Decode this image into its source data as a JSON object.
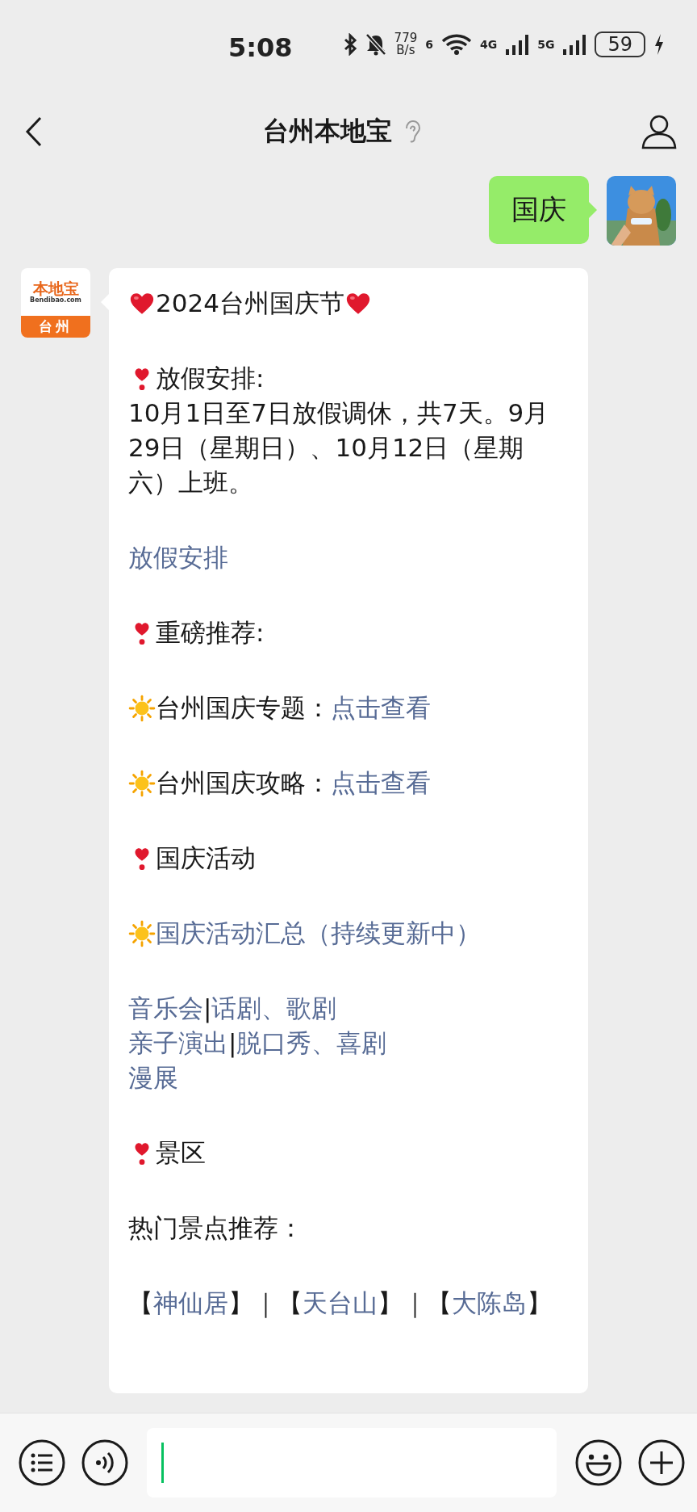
{
  "status_bar": {
    "time": "5:08",
    "speed_value": "779",
    "speed_unit": "B/s",
    "wifi_badge": "6",
    "sim1": "4G",
    "sim2": "5G",
    "battery": "59"
  },
  "header": {
    "title": "台州本地宝"
  },
  "messages": [
    {
      "kind": "sent",
      "text": "国庆"
    },
    {
      "kind": "received",
      "avatar": {
        "brand": "本地宝",
        "site": "Bendibao.com",
        "city": "台州"
      },
      "blocks": [
        [
          [
            {
              "kind": "heart"
            },
            {
              "kind": "text",
              "text": "2024台州国庆节"
            },
            {
              "kind": "heart"
            }
          ]
        ],
        [
          [
            {
              "kind": "exclaim"
            },
            {
              "kind": "text",
              "text": "放假安排:"
            }
          ],
          [
            {
              "kind": "text",
              "text": "10月1日至7日放假调休，共7天。9月29日（星期日）、10月12日（星期六）上班。"
            }
          ]
        ],
        [
          [
            {
              "kind": "link",
              "text": "放假安排"
            }
          ]
        ],
        [
          [
            {
              "kind": "exclaim"
            },
            {
              "kind": "text",
              "text": "重磅推荐:"
            }
          ]
        ],
        [
          [
            {
              "kind": "sun"
            },
            {
              "kind": "text",
              "text": "台州国庆专题："
            },
            {
              "kind": "link",
              "text": "点击查看"
            }
          ]
        ],
        [
          [
            {
              "kind": "sun"
            },
            {
              "kind": "text",
              "text": "台州国庆攻略："
            },
            {
              "kind": "link",
              "text": "点击查看"
            }
          ]
        ],
        [
          [
            {
              "kind": "exclaim"
            },
            {
              "kind": "text",
              "text": "国庆活动"
            }
          ]
        ],
        [
          [
            {
              "kind": "sun"
            },
            {
              "kind": "link",
              "text": "国庆活动汇总（持续更新中）"
            }
          ]
        ],
        [
          [
            {
              "kind": "link",
              "text": "音乐会"
            },
            {
              "kind": "text",
              "text": "|"
            },
            {
              "kind": "link",
              "text": "话剧、歌剧"
            }
          ],
          [
            {
              "kind": "link",
              "text": "亲子演出"
            },
            {
              "kind": "text",
              "text": "|"
            },
            {
              "kind": "link",
              "text": "脱口秀、喜剧"
            }
          ],
          [
            {
              "kind": "link",
              "text": "漫展"
            }
          ]
        ],
        [
          [
            {
              "kind": "exclaim"
            },
            {
              "kind": "text",
              "text": "景区"
            }
          ]
        ],
        [
          [
            {
              "kind": "text",
              "text": "热门景点推荐："
            }
          ]
        ],
        [
          [
            {
              "kind": "text",
              "text": "【"
            },
            {
              "kind": "link",
              "text": "神仙居"
            },
            {
              "kind": "text",
              "text": "】｜【"
            },
            {
              "kind": "link",
              "text": "天台山"
            },
            {
              "kind": "text",
              "text": "】｜【"
            },
            {
              "kind": "link",
              "text": "大陈岛"
            },
            {
              "kind": "text",
              "text": "】"
            }
          ]
        ]
      ]
    }
  ]
}
